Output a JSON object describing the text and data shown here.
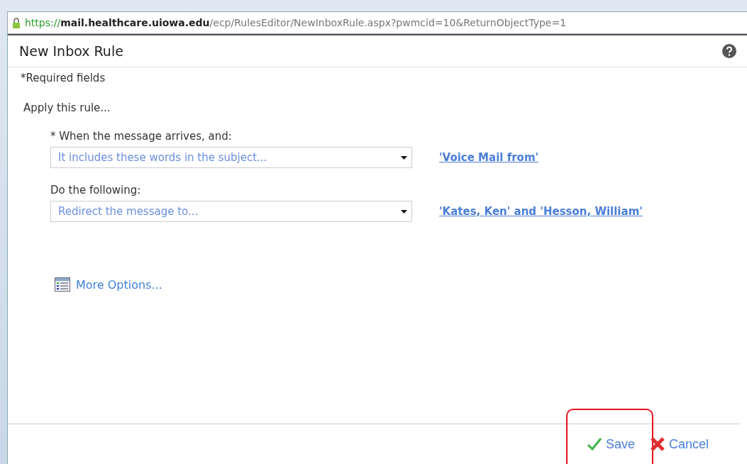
{
  "address_bar": {
    "scheme": "https://",
    "host": "mail.healthcare.uiowa.edu",
    "path": "/ecp/RulesEditor/NewInboxRule.aspx?pwmcid=10&ReturnObjectType=1"
  },
  "window": {
    "title": "New Inbox Rule"
  },
  "required_note": "*Required fields",
  "section_label": "Apply this rule...",
  "conditions": [
    {
      "label": "* When the message arrives, and:",
      "value": "It includes these words in the subject...",
      "link": "'Voice Mail from'"
    },
    {
      "label": "Do the following:",
      "value": "Redirect the message to...",
      "link": "'Kates, Ken' and 'Hesson, William'"
    }
  ],
  "more_options": "More Options...",
  "buttons": [
    {
      "kind": "save",
      "label": "Save",
      "highlighted": true
    },
    {
      "kind": "cancel",
      "label": "Cancel",
      "highlighted": false
    }
  ]
}
